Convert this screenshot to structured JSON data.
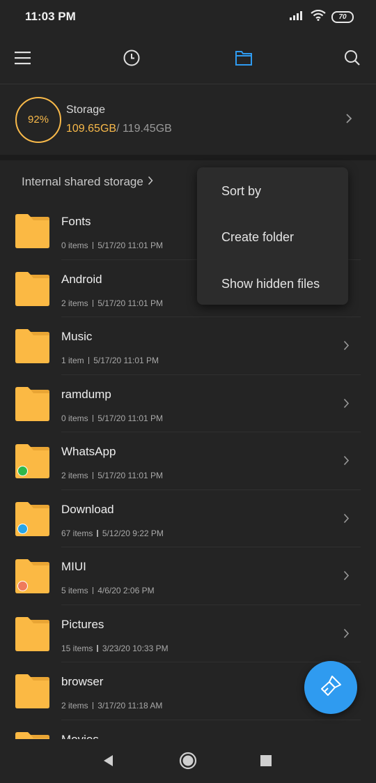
{
  "status_bar": {
    "time": "11:03 PM",
    "battery": "70"
  },
  "toolbar": {
    "menu_icon": "hamburger-menu-icon",
    "recent_icon": "clock-icon",
    "files_icon": "folder-icon",
    "search_icon": "search-icon"
  },
  "storage": {
    "percent": "92%",
    "label": "Storage",
    "used": "109.65GB",
    "total": "/ 119.45GB",
    "ring_color": "#f8b94a"
  },
  "breadcrumb": {
    "path": "Internal shared storage"
  },
  "context_menu": {
    "items": [
      "Sort by",
      "Create folder",
      "Show hidden files"
    ]
  },
  "folders": [
    {
      "name": "Fonts",
      "count": "0 items",
      "date": "5/17/20 11:01 PM",
      "badge": ""
    },
    {
      "name": "Android",
      "count": "2 items",
      "date": "5/17/20 11:01 PM",
      "badge": ""
    },
    {
      "name": "Music",
      "count": "1 item",
      "date": "5/17/20 11:01 PM",
      "badge": ""
    },
    {
      "name": "ramdump",
      "count": "0 items",
      "date": "5/17/20 11:01 PM",
      "badge": ""
    },
    {
      "name": "WhatsApp",
      "count": "2 items",
      "date": "5/17/20 11:01 PM",
      "badge": "whatsapp-icon"
    },
    {
      "name": "Download",
      "count": "67 items",
      "date": "5/12/20 9:22 PM",
      "badge": "download-icon"
    },
    {
      "name": "MIUI",
      "count": "5 items",
      "date": "4/6/20 2:06 PM",
      "badge": "miui-icon"
    },
    {
      "name": "Pictures",
      "count": "15 items",
      "date": "3/23/20 10:33 PM",
      "badge": ""
    },
    {
      "name": "browser",
      "count": "2 items",
      "date": "3/17/20 11:18 AM",
      "badge": ""
    },
    {
      "name": "Movies",
      "count": "",
      "date": "",
      "badge": ""
    }
  ],
  "colors": {
    "background": "#242424",
    "accent": "#2f9bf0",
    "folder": "#fbb944",
    "whatsapp_badge": "#2fb84a",
    "download_badge": "#29a5e6",
    "miui_badge": "#ef7b5c"
  },
  "fab": {
    "icon": "cleaner-brush-icon"
  },
  "nav_bar": {
    "back_icon": "back-triangle-icon",
    "home_icon": "home-circle-icon",
    "recents_icon": "recents-square-icon"
  }
}
